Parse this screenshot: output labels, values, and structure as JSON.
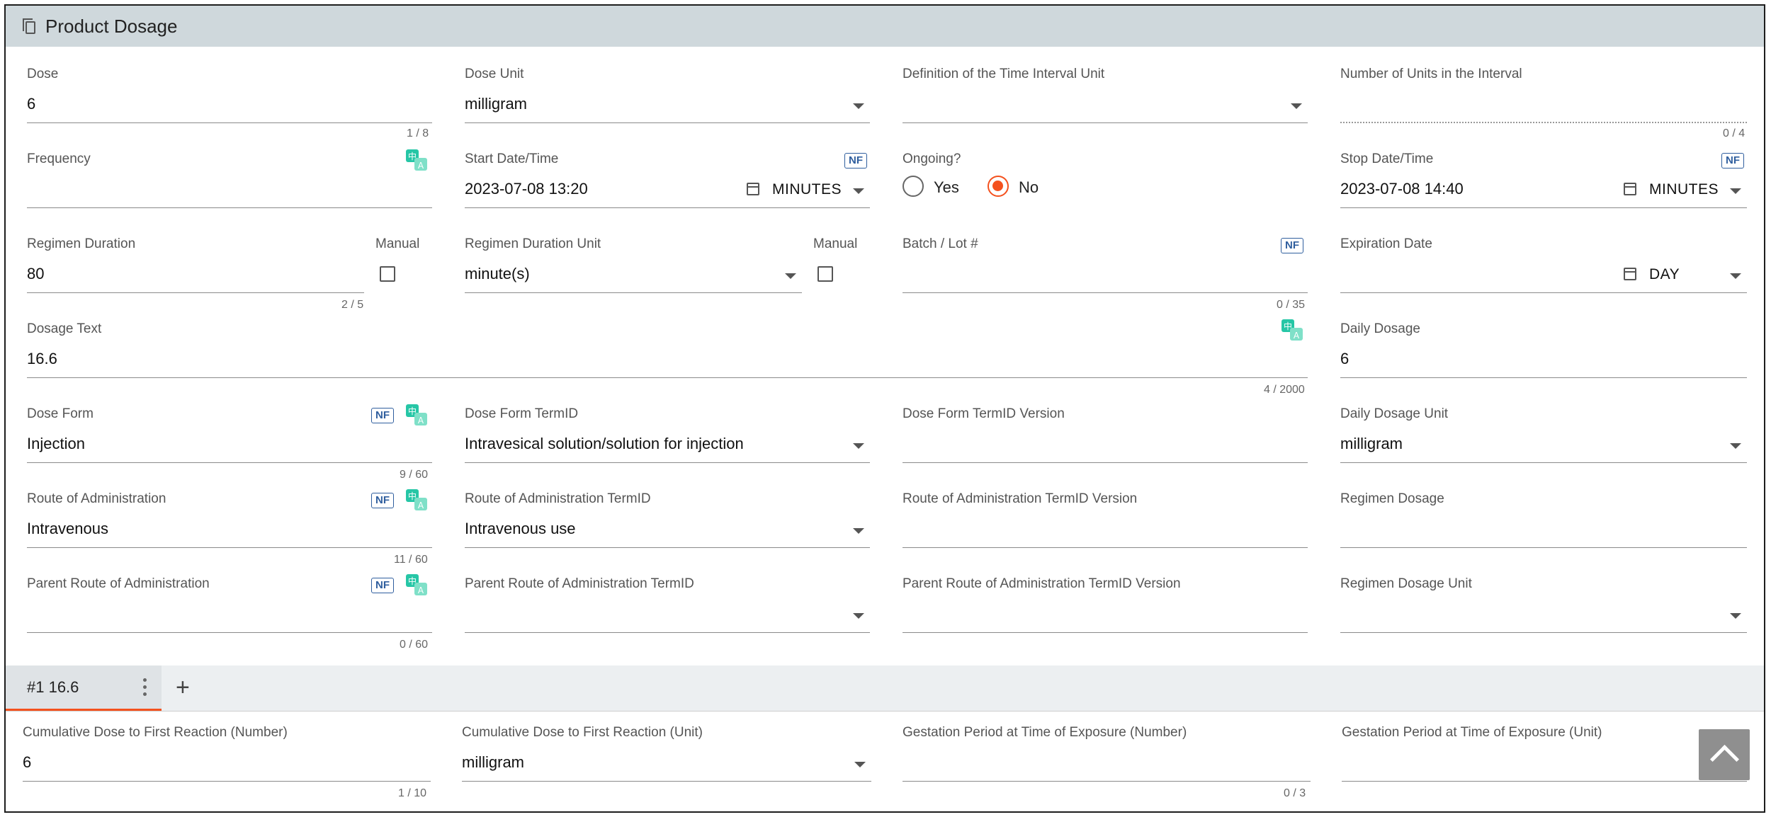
{
  "section": {
    "title": "Product Dosage",
    "icon": "document-copy-icon"
  },
  "nf_label": "NF",
  "manual_label": "Manual",
  "fields": {
    "dose": {
      "label": "Dose",
      "value": "6",
      "counter": "1 / 8"
    },
    "dose_unit": {
      "label": "Dose Unit",
      "value": "milligram"
    },
    "time_interval_unit": {
      "label": "Definition of the Time Interval Unit",
      "value": ""
    },
    "units_in_interval": {
      "label": "Number of Units in the Interval",
      "value": "",
      "counter": "0 / 4"
    },
    "frequency": {
      "label": "Frequency",
      "value": ""
    },
    "start_datetime": {
      "label": "Start Date/Time",
      "value": "2023-07-08 13:20",
      "precision": "MINUTES"
    },
    "ongoing": {
      "label": "Ongoing?",
      "options": [
        "Yes",
        "No"
      ],
      "selected": "No"
    },
    "stop_datetime": {
      "label": "Stop Date/Time",
      "value": "2023-07-08 14:40",
      "precision": "MINUTES"
    },
    "regimen_duration": {
      "label": "Regimen Duration",
      "value": "80",
      "counter": "2 / 5",
      "manual": false
    },
    "regimen_duration_unit": {
      "label": "Regimen Duration Unit",
      "value": "minute(s)",
      "manual": false
    },
    "batch_lot": {
      "label": "Batch / Lot #",
      "value": "",
      "counter": "0 / 35"
    },
    "expiration_date": {
      "label": "Expiration Date",
      "value": "",
      "precision": "DAY"
    },
    "dosage_text": {
      "label": "Dosage Text",
      "value": "16.6",
      "counter": "4 / 2000"
    },
    "daily_dosage": {
      "label": "Daily Dosage",
      "value": "6"
    },
    "dose_form": {
      "label": "Dose Form",
      "value": "Injection",
      "counter": "9 / 60"
    },
    "dose_form_termid": {
      "label": "Dose Form TermID",
      "value": "Intravesical solution/solution for injection"
    },
    "dose_form_termid_version": {
      "label": "Dose Form TermID Version",
      "value": ""
    },
    "daily_dosage_unit": {
      "label": "Daily Dosage Unit",
      "value": "milligram"
    },
    "route_admin": {
      "label": "Route of Administration",
      "value": "Intravenous",
      "counter": "11 / 60"
    },
    "route_admin_termid": {
      "label": "Route of Administration TermID",
      "value": "Intravenous use"
    },
    "route_admin_termid_version": {
      "label": "Route of Administration TermID Version",
      "value": ""
    },
    "regimen_dosage": {
      "label": "Regimen Dosage",
      "value": ""
    },
    "parent_route": {
      "label": "Parent Route of Administration",
      "value": "",
      "counter": "0 / 60"
    },
    "parent_route_termid": {
      "label": "Parent Route of Administration TermID",
      "value": ""
    },
    "parent_route_termid_version": {
      "label": "Parent Route of Administration TermID Version",
      "value": ""
    },
    "regimen_dosage_unit": {
      "label": "Regimen Dosage Unit",
      "value": ""
    }
  },
  "tabs": [
    {
      "label": "#1 16.6",
      "active": true
    }
  ],
  "add_tab_label": "+",
  "bottom": {
    "cum_dose_number": {
      "label": "Cumulative Dose to First Reaction (Number)",
      "value": "6",
      "counter": "1 / 10"
    },
    "cum_dose_unit": {
      "label": "Cumulative Dose to First Reaction (Unit)",
      "value": "milligram"
    },
    "gestation_number": {
      "label": "Gestation Period at Time of Exposure (Number)",
      "value": "",
      "counter": "0 / 3"
    },
    "gestation_unit": {
      "label": "Gestation Period at Time of Exposure (Unit)",
      "value": ""
    }
  },
  "colors": {
    "header_bg": "#cfd8dc",
    "accent": "#f4511e",
    "nf_blue": "#2f5e9e",
    "translate_green": "#26c6a6"
  }
}
